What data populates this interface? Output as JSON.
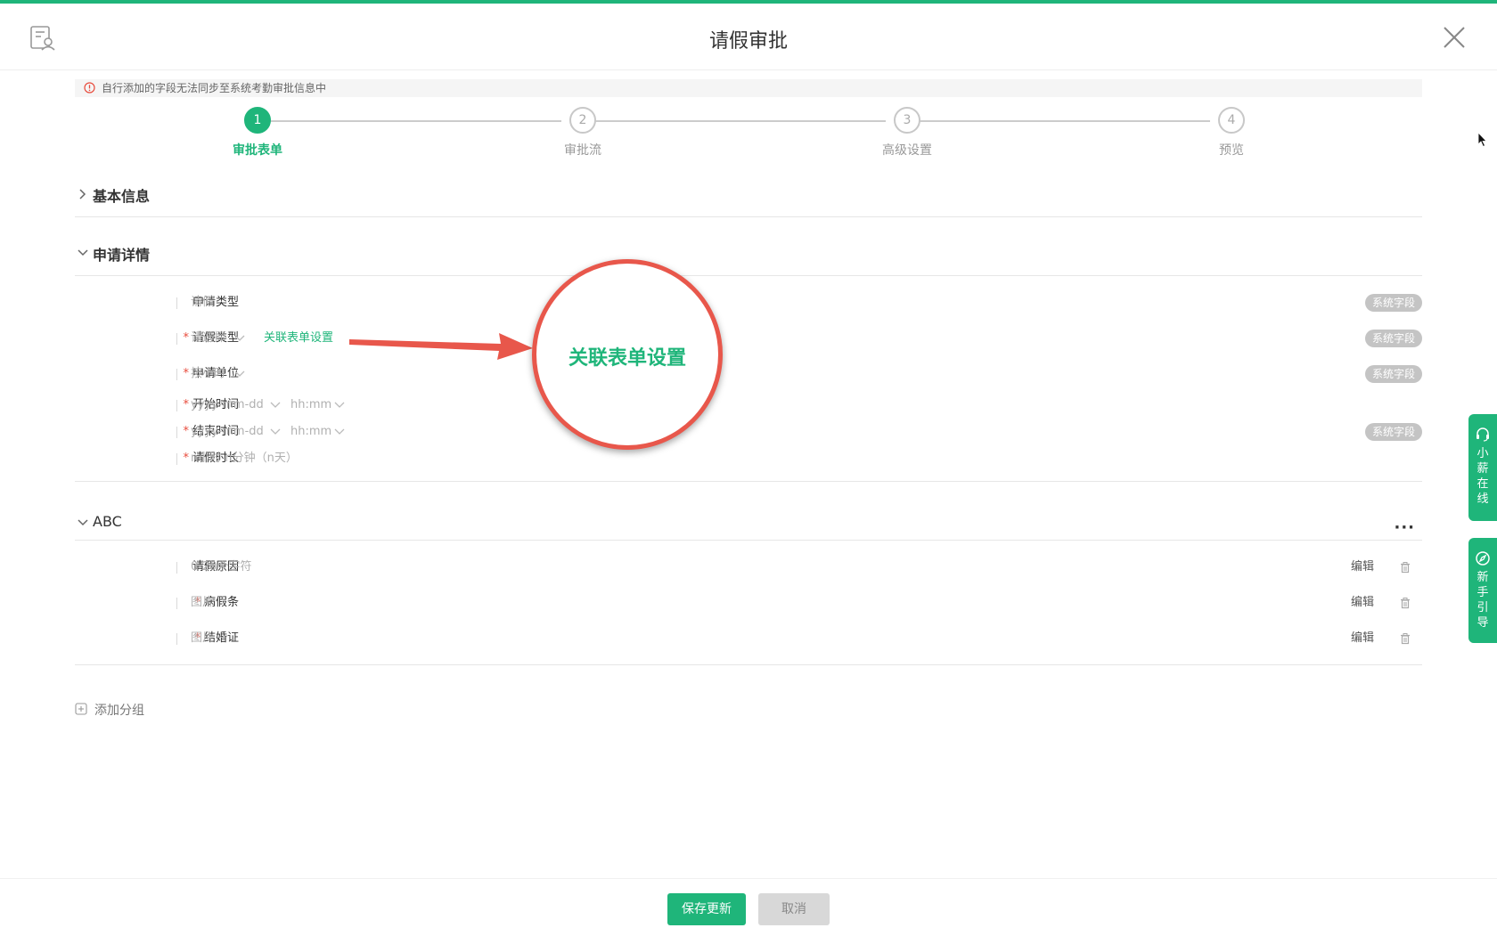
{
  "header": {
    "title": "请假审批"
  },
  "notice": {
    "text": "自行添加的字段无法同步至系统考勤审批信息中"
  },
  "steps": [
    {
      "num": "1",
      "label": "审批表单",
      "active": true
    },
    {
      "num": "2",
      "label": "审批流",
      "active": false
    },
    {
      "num": "3",
      "label": "高级设置",
      "active": false
    },
    {
      "num": "4",
      "label": "预览",
      "active": false
    }
  ],
  "sections": {
    "basic": {
      "title": "基本信息"
    },
    "detail": {
      "title": "申请详情",
      "badge": "系统字段",
      "rows": {
        "apply_type": {
          "label": "申请类型",
          "placeholder": "请假"
        },
        "leave_type": {
          "label": "请假类型",
          "placeholder": "请选择",
          "link": "关联表单设置"
        },
        "apply_unit": {
          "label": "申请单位",
          "placeholder": "按小时"
        },
        "start_time": {
          "label": "开始时间",
          "date": "yyyy-mm-dd",
          "time": "hh:mm"
        },
        "end_time": {
          "label": "结束时间",
          "date": "yyyy-mm-dd",
          "time": "hh:mm"
        },
        "duration": {
          "label": "请假时长",
          "placeholder": "n小时 n分钟（n天）"
        }
      }
    },
    "abc": {
      "title": "ABC",
      "more": "···",
      "edit_label": "编辑",
      "rows": {
        "reason": {
          "label": "请假原因",
          "placeholder": "0-20个字符"
        },
        "sick_note": {
          "label": "病假条",
          "placeholder": "图片"
        },
        "marriage_cert": {
          "label": "结婚证",
          "placeholder": "图片"
        }
      }
    }
  },
  "required_mark": "*",
  "add_group": {
    "label": "添加分组"
  },
  "annotation": {
    "text": "关联表单设置"
  },
  "side_tabs": {
    "online": {
      "label": "小薪在线",
      "chars": [
        "小",
        "薪",
        "在",
        "线"
      ]
    },
    "guide": {
      "label": "新手引导",
      "chars": [
        "新",
        "手",
        "引",
        "导"
      ]
    }
  },
  "footer": {
    "save_label": "保存更新",
    "cancel_label": "取消"
  },
  "colors": {
    "accent": "#1fb57a",
    "annotation_red": "#e8574b",
    "required": "#e84c3d",
    "badge": "#c4c4c4"
  }
}
